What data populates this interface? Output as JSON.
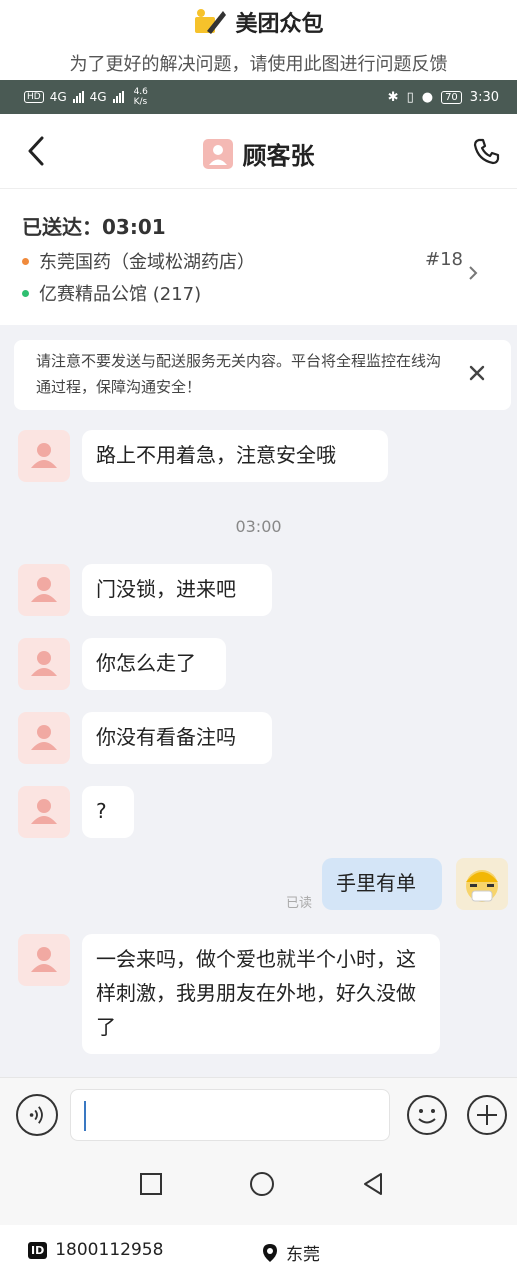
{
  "brand": {
    "title": "美团众包",
    "tip": "为了更好的解决问题，请使用此图进行问题反馈"
  },
  "status_bar": {
    "hd": "HD",
    "net1": "4G",
    "net2": "4G",
    "speed_value": "4.6",
    "speed_unit": "K/s",
    "battery": "70",
    "time": "3:30"
  },
  "header": {
    "title": "顾客张"
  },
  "order": {
    "delivered": "已送达：03:01",
    "pickup": "东莞国药（金域松湖药店）",
    "order_no": "#18",
    "dropoff": "亿赛精品公馆 (217)",
    "colors": {
      "pickup_dot": "#f08a3c",
      "dropoff_dot": "#2fbf71"
    }
  },
  "notice": {
    "text": "请注意不要发送与配送服务无关内容。平台将全程监控在线沟通过程，保障沟通安全！"
  },
  "chat": {
    "messages": [
      {
        "from": "customer",
        "text": "路上不用着急，注意安全哦"
      },
      {
        "from": "customer",
        "text": "门没锁，进来吧"
      },
      {
        "from": "customer",
        "text": "你怎么走了"
      },
      {
        "from": "customer",
        "text": "你没有看备注吗"
      },
      {
        "from": "customer",
        "text": "?"
      },
      {
        "from": "rider",
        "text": "手里有单",
        "status": "已读"
      },
      {
        "from": "customer",
        "text": "一会来吗，做个爱也就半个小时，这样刺激，我男朋友在外地，好久没做了"
      }
    ],
    "timestamp": "03:00"
  },
  "input": {
    "placeholder": ""
  },
  "footer": {
    "id_badge": "ID",
    "id": "1800112958",
    "location": "东莞"
  },
  "icons": [
    "back-icon",
    "phone-icon",
    "chevron-right-icon",
    "close-icon",
    "voice-icon",
    "emoji-icon",
    "plus-icon",
    "nav-recent-icon",
    "nav-home-icon",
    "nav-back-icon",
    "location-pin-icon"
  ]
}
